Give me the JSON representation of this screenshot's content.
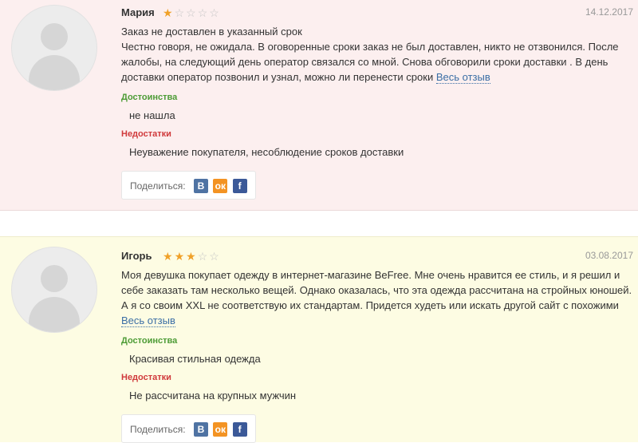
{
  "reviews": [
    {
      "author": "Мария",
      "rating": 1,
      "date": "14.12.2017",
      "title": "Заказ не доставлен в указанный срок",
      "text": "Честно говоря, не ожидала. В оговоренные сроки заказ не был доставлен, никто не отзвонился. После жалобы, на следующий день оператор связался со мной. Снова обговорили сроки доставки . В день доставки оператор позвонил и узнал, можно ли перенести сроки",
      "more_label": "Весь отзыв",
      "pros_label": "Достоинства",
      "pros": "не нашла",
      "cons_label": "Недостатки",
      "cons": "Неуважение покупателя, несоблюдение сроков доставки",
      "share_label": "Поделиться:"
    },
    {
      "author": "Игорь",
      "rating": 3,
      "date": "03.08.2017",
      "title": "",
      "text": "Моя девушка покупает одежду в интернет-магазине BeFree. Мне очень нравится ее стиль, и я решил и себе заказать там несколько вещей. Однако оказалась, что эта одежда рассчитана на стройных юношей. А я со своим XXL не соответствую их стандартам. Придется худеть или искать другой сайт с похожими",
      "more_label": "Весь отзыв",
      "pros_label": "Достоинства",
      "pros": "Красивая стильная одежда",
      "cons_label": "Недостатки",
      "cons": "Не рассчитана на крупных мужчин",
      "share_label": "Поделиться:"
    }
  ],
  "social": {
    "vk_glyph": "В",
    "ok_glyph": "ок",
    "fb_glyph": "f",
    "vk_icon": "vk-icon",
    "ok_icon": "odnoklassniki-icon",
    "fb_icon": "facebook-icon"
  },
  "colors": {
    "star_on": "#f0a128",
    "star_off": "#c6c6c6",
    "pros": "#4c9b35",
    "cons": "#d0393b",
    "link": "#3b6ea5",
    "review_bg_negative": "#fcefef",
    "review_bg_neutral": "#fdfce3"
  }
}
